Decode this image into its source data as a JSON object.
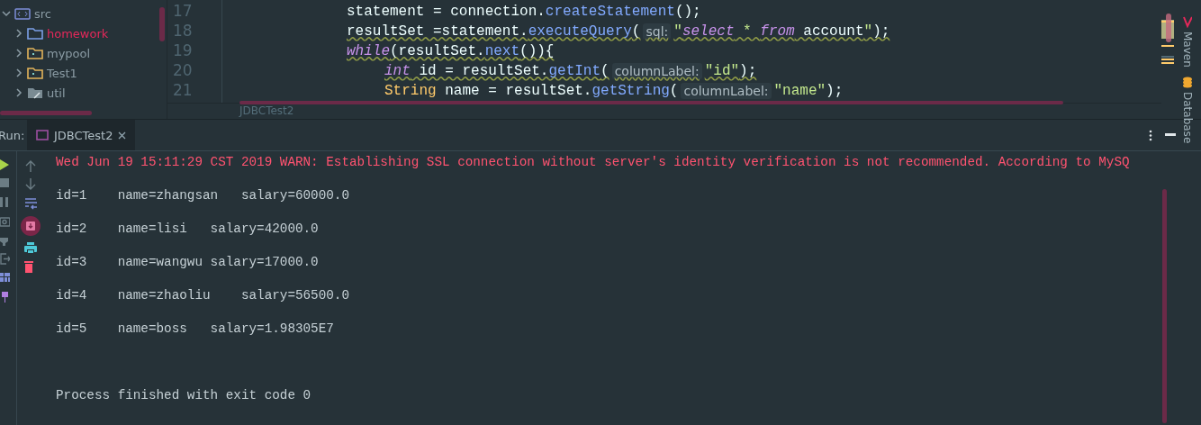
{
  "project_tree": {
    "items": [
      {
        "label": "src",
        "kind": "source",
        "highlighted": false,
        "expanded": true
      },
      {
        "label": "homework",
        "kind": "package",
        "highlighted": true,
        "expanded": false
      },
      {
        "label": "mypool",
        "kind": "module",
        "highlighted": false,
        "expanded": false
      },
      {
        "label": "Test1",
        "kind": "module",
        "highlighted": false,
        "expanded": false
      },
      {
        "label": "util",
        "kind": "excluded",
        "highlighted": false,
        "expanded": false
      }
    ]
  },
  "editor": {
    "lines": [
      {
        "number": "17",
        "warning": false,
        "tokens": [
          {
            "kind": "plain",
            "text": "statement = connection."
          },
          {
            "kind": "method",
            "text": "createStatement"
          },
          {
            "kind": "plain",
            "text": "();"
          }
        ]
      },
      {
        "number": "18",
        "warning": true,
        "tokens": [
          {
            "kind": "plain",
            "text": "resultSet =statement."
          },
          {
            "kind": "method",
            "text": "executeQuery"
          },
          {
            "kind": "plain",
            "text": "("
          },
          {
            "kind": "hint",
            "text": "sql:"
          },
          {
            "kind": "string",
            "text": "\""
          },
          {
            "kind": "sql",
            "text": "select"
          },
          {
            "kind": "string",
            "text": " * "
          },
          {
            "kind": "sql",
            "text": "from"
          },
          {
            "kind": "plain",
            "text": " account"
          },
          {
            "kind": "string",
            "text": "\""
          },
          {
            "kind": "plain",
            "text": ");"
          }
        ]
      },
      {
        "number": "19",
        "warning": true,
        "tokens": [
          {
            "kind": "keyword",
            "text": "while"
          },
          {
            "kind": "plain",
            "text": "(resultSet."
          },
          {
            "kind": "method",
            "text": "next"
          },
          {
            "kind": "plain",
            "text": "()){"
          }
        ],
        "children": [
          {
            "number": "20",
            "warning": true,
            "tokens": [
              {
                "kind": "keyword",
                "text": "int"
              },
              {
                "kind": "plain",
                "text": " id = resultSet."
              },
              {
                "kind": "method",
                "text": "getInt"
              },
              {
                "kind": "plain",
                "text": "("
              },
              {
                "kind": "hint",
                "text": "columnLabel:"
              },
              {
                "kind": "string",
                "text": "\"id\""
              },
              {
                "kind": "plain",
                "text": ");"
              }
            ]
          },
          {
            "number": "21",
            "warning": false,
            "tokens": [
              {
                "kind": "type",
                "text": "String"
              },
              {
                "kind": "plain",
                "text": " name = resultSet."
              },
              {
                "kind": "method",
                "text": "getString"
              },
              {
                "kind": "plain",
                "text": "("
              },
              {
                "kind": "hint",
                "text": "columnLabel:"
              },
              {
                "kind": "string",
                "text": "\"name\""
              },
              {
                "kind": "plain",
                "text": ");"
              }
            ]
          }
        ]
      }
    ],
    "breadcrumb": "JDBCTest2"
  },
  "side_tools": [
    {
      "label": "Maven",
      "kind": "maven"
    },
    {
      "label": "Database",
      "kind": "database"
    }
  ],
  "run_panel": {
    "label": "Run:",
    "tabs": [
      {
        "label": "JDBCTest2",
        "selected": true
      }
    ],
    "console": [
      {
        "kind": "error",
        "text": "Wed Jun 19 15:11:29 CST 2019 WARN: Establishing SSL connection without server's identity verification is not recommended. According to MySQ"
      },
      {
        "kind": "output",
        "text": "id=1    name=zhangsan   salary=60000.0"
      },
      {
        "kind": "output",
        "text": "id=2    name=lisi   salary=42000.0"
      },
      {
        "kind": "output",
        "text": "id=3    name=wangwu salary=17000.0"
      },
      {
        "kind": "output",
        "text": "id=4    name=zhaoliu    salary=56500.0"
      },
      {
        "kind": "output",
        "text": "id=5    name=boss   salary=1.98305E7"
      },
      {
        "kind": "exit",
        "text": "Process finished with exit code 0"
      }
    ]
  }
}
